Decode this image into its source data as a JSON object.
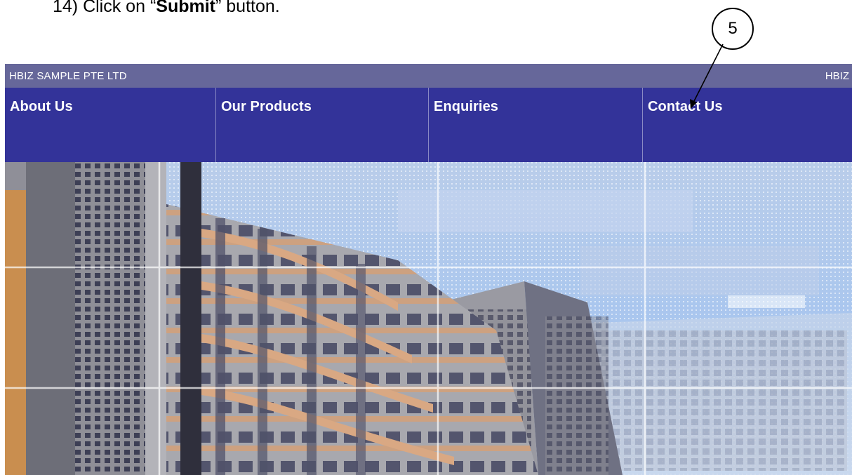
{
  "instruction": {
    "prefix": "14) Click on “",
    "bold_word": "Submit",
    "suffix": "” button."
  },
  "callout": {
    "number": "5"
  },
  "site": {
    "company_name": "HBIZ SAMPLE PTE LTD",
    "brand": "HBIZ",
    "nav": [
      {
        "label": "About Us"
      },
      {
        "label": "Our Products"
      },
      {
        "label": "Enquiries"
      },
      {
        "label": "Contact Us"
      }
    ]
  },
  "colors": {
    "topbar": "#66679a",
    "navbar": "#333399",
    "nav_text": "#ffffff"
  }
}
